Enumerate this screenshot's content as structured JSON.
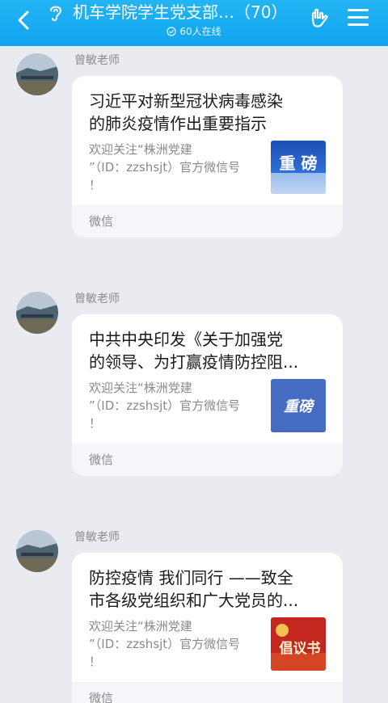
{
  "header": {
    "title": "机车学院学生党支部…（70）",
    "online": "60人在线"
  },
  "messages": [
    {
      "sender": "曾敏老师",
      "title": "习近平对新型冠状病毒感染\n的肺炎疫情作出重要指示",
      "desc": "欢迎关注“株洲党建\n”（ID：zzshsjt）官方微信号\n！",
      "thumb_text": "重 磅",
      "source": "微信"
    },
    {
      "sender": "曾敏老师",
      "title": "中共中央印发《关于加强党\n的领导、为打赢疫情防控阻...",
      "desc": "欢迎关注“株洲党建\n”（ID：zzshsjt）官方微信号\n！",
      "thumb_text": "重磅",
      "source": "微信"
    },
    {
      "sender": "曾敏老师",
      "title": "防控疫情 我们同行 ——致全\n市各级党组织和广大党员的...",
      "desc": "欢迎关注“株洲党建\n”（ID：zzshsjt）官方微信号\n！",
      "thumb_text": "倡议书",
      "source": "微信"
    }
  ],
  "colors": {
    "header": "#12a5f0",
    "background": "#eaebf0",
    "card": "#ffffff",
    "footer": "#f5f6f9"
  }
}
